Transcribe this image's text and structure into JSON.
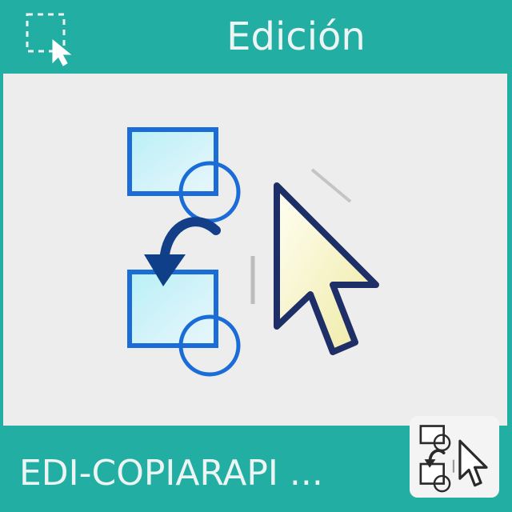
{
  "header": {
    "title": "Edición",
    "icon": "selection-cursor-icon"
  },
  "preview": {
    "icon": "copy-shape-cursor-icon"
  },
  "footer": {
    "name": "EDI-COPIARAPI ...",
    "thumbnail_icon": "copy-shape-cursor-icon"
  },
  "colors": {
    "accent": "#23aea3",
    "preview_bg": "#ededed",
    "text": "#ecf5f3",
    "shape_blue": "#1a6cd6",
    "arrow_dark": "#0f3f88",
    "cursor_fill": "#fbf9d8",
    "cursor_outline": "#1d2f66"
  }
}
